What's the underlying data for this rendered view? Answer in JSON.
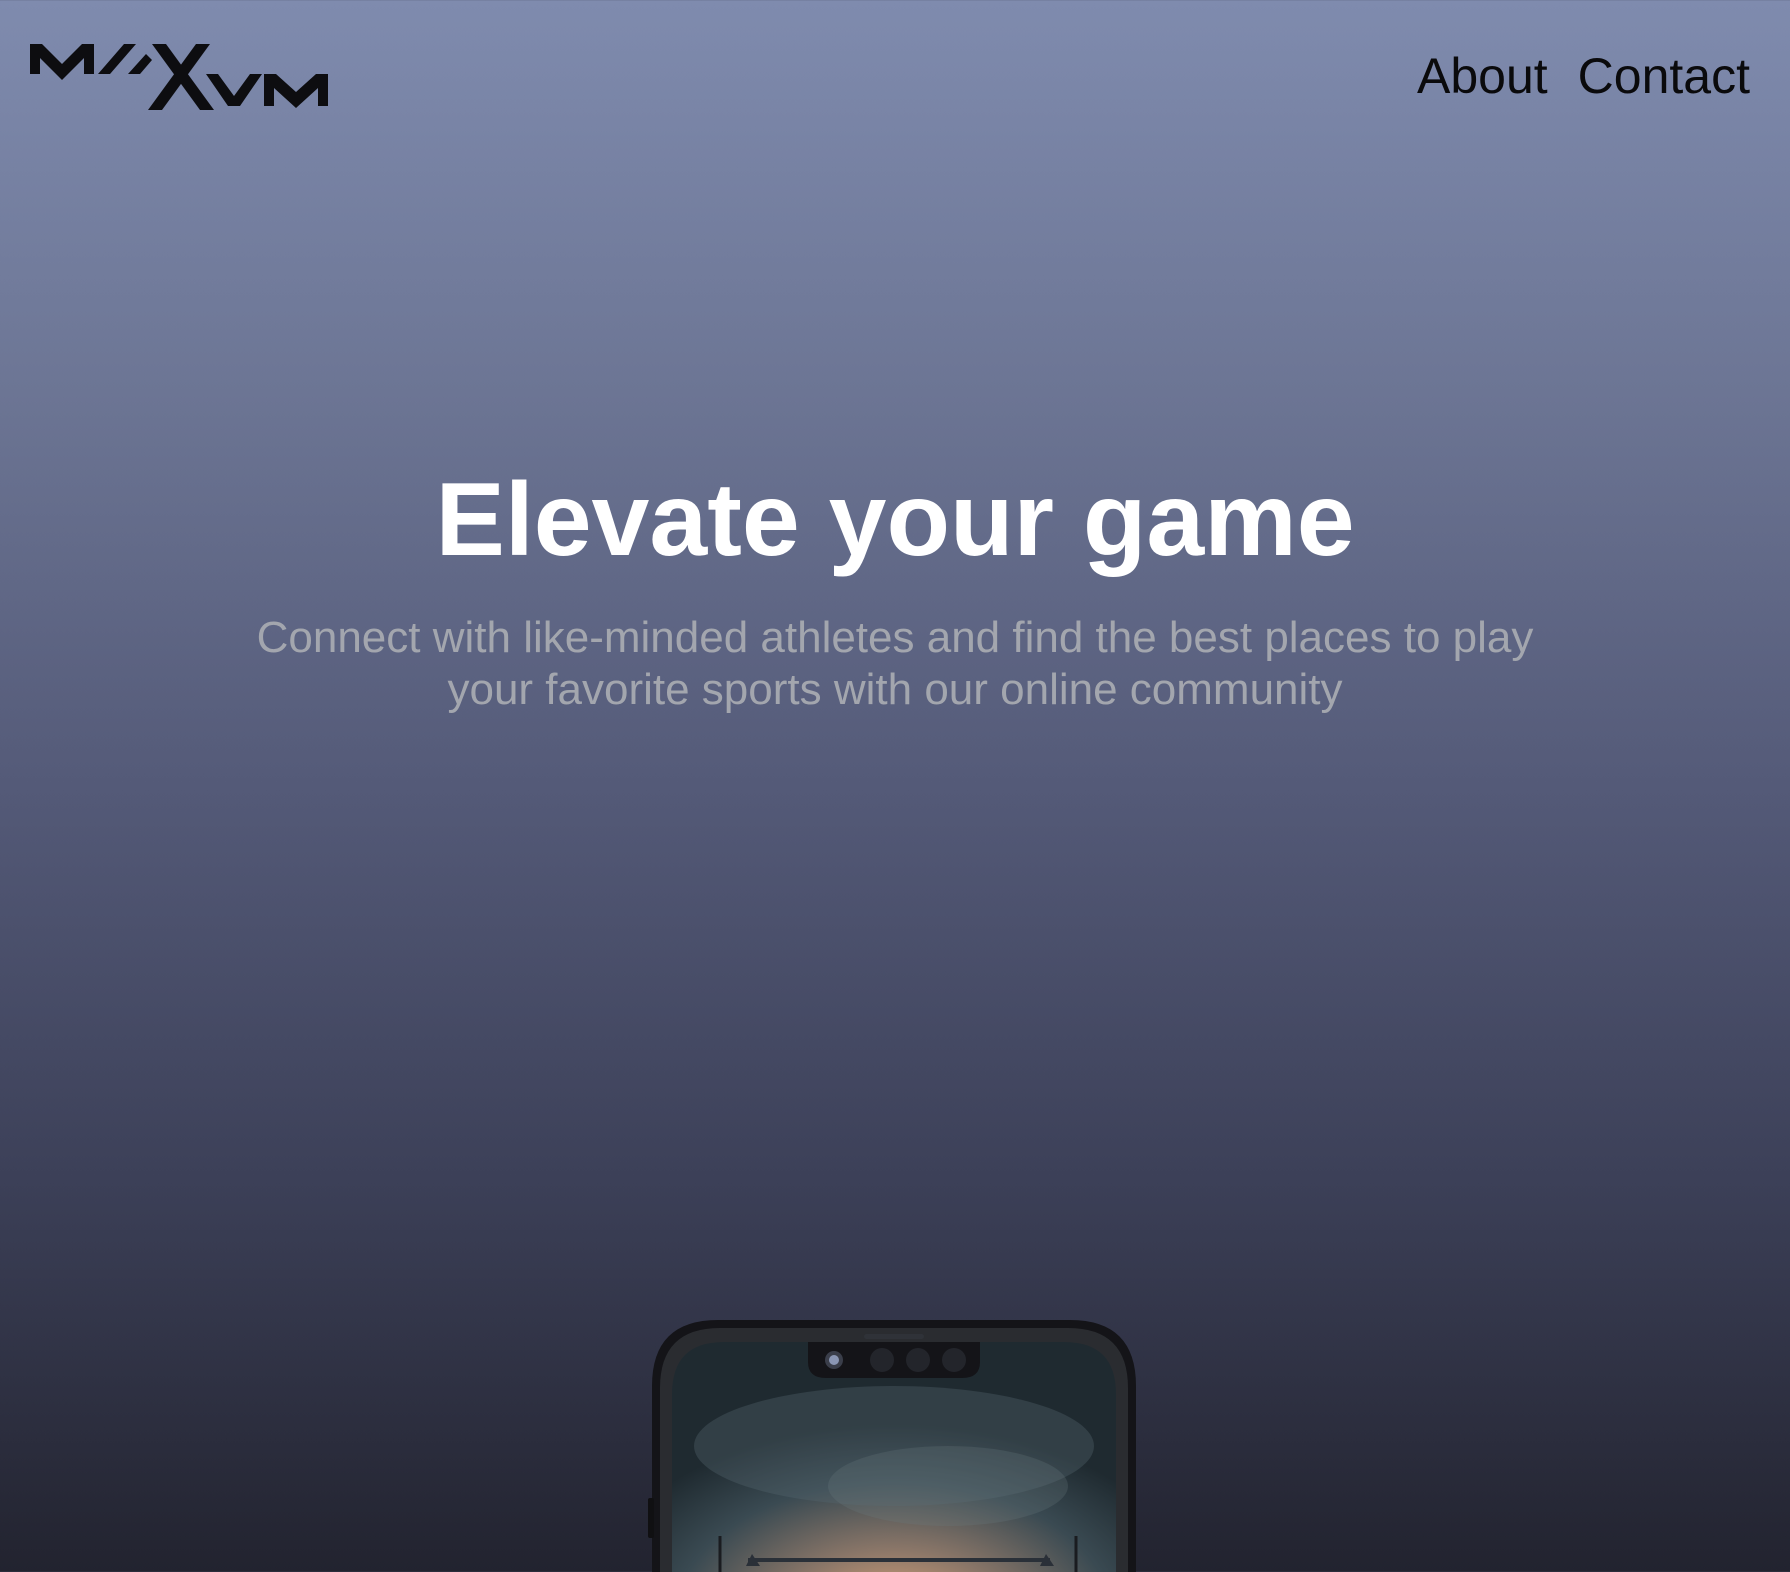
{
  "brand": {
    "logo_text": "MAXVM"
  },
  "nav": {
    "items": [
      {
        "label": "About"
      },
      {
        "label": "Contact"
      }
    ]
  },
  "hero": {
    "title": "Elevate your game",
    "subtitle": "Connect with like-minded athletes and find the best places to play your favorite sports with our online community"
  },
  "colors": {
    "bg_top": "#7f8bae",
    "bg_bottom": "#22232f",
    "title": "#ffffff",
    "subtitle": "#a3a6ae",
    "nav": "#0a0a0c"
  },
  "icons": {
    "logo": "maxvm-logo",
    "phone": "phone-mockup"
  }
}
